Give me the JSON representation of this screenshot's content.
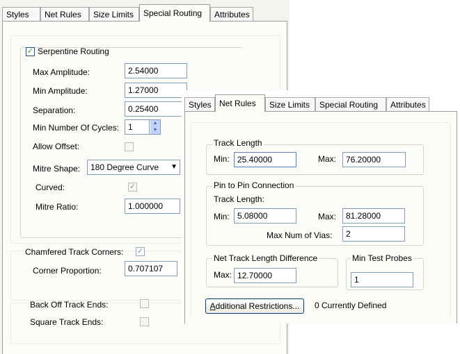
{
  "dialog1": {
    "tabs": [
      "Styles",
      "Net Rules",
      "Size Limits",
      "Special Routing",
      "Attributes"
    ],
    "active_tab": "Special Routing",
    "serpentine": {
      "label": "Serpentine Routing",
      "checked": true,
      "max_amplitude_label": "Max Amplitude:",
      "max_amplitude": "2.54000",
      "min_amplitude_label": "Min Amplitude:",
      "min_amplitude": "1.27000",
      "separation_label": "Separation:",
      "separation": "0.25400",
      "min_cycles_label": "Min Number Of Cycles:",
      "min_cycles": "1",
      "allow_offset_label": "Allow Offset:",
      "mitre_shape_label": "Mitre Shape:",
      "mitre_shape": "180 Degree Curve",
      "curved_label": "Curved:",
      "mitre_ratio_label": "Mitre Ratio:",
      "mitre_ratio": "1.000000"
    },
    "chamfered": {
      "label": "Chamfered Track Corners:",
      "corner_proportion_label": "Corner Proportion:",
      "corner_proportion": "0.707107"
    },
    "back_off_label": "Back Off Track Ends:",
    "square_ends_label": "Square Track Ends:"
  },
  "dialog2": {
    "tabs": [
      "Styles",
      "Net Rules",
      "Size Limits",
      "Special Routing",
      "Attributes"
    ],
    "active_tab": "Net Rules",
    "track_length": {
      "label": "Track Length",
      "min_label": "Min:",
      "min": "25.40000",
      "max_label": "Max:",
      "max": "76.20000"
    },
    "pin_to_pin": {
      "label": "Pin to Pin Connection",
      "track_length_label": "Track Length:",
      "min_label": "Min:",
      "min": "5.08000",
      "max_label": "Max:",
      "max": "81.28000",
      "max_vias_label": "Max Num of Vias:",
      "max_vias": "2"
    },
    "net_diff": {
      "label": "Net Track Length Difference",
      "max_label": "Max:",
      "max": "12.70000"
    },
    "test_probes": {
      "label": "Min Test Probes",
      "value": "1"
    },
    "additional_button": "Additional Restrictions...",
    "defined_status": "0 Currently Defined"
  }
}
